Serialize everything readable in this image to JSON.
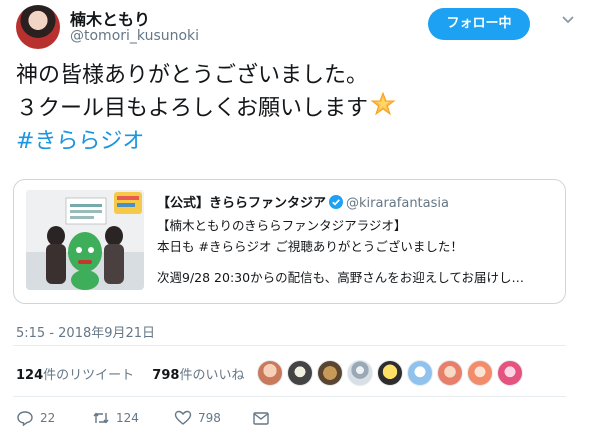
{
  "user": {
    "display_name": "楠木ともり",
    "handle": "@tomori_kusunoki",
    "avatar_icon": "profile-avatar"
  },
  "follow_button": {
    "label": "フォロー中"
  },
  "menu_icon": "chevron-down-icon",
  "tweet": {
    "lines": [
      "神の皆様ありがとうございました。",
      "３クール目もよろしくお願いします"
    ],
    "emoji": "glowing-star-icon",
    "hashtag": "#きららジオ"
  },
  "quoted_tweet": {
    "name": "【公式】きららファンタジア",
    "handle": "@kirarafantasia",
    "verified_icon": "verified-badge-icon",
    "lines": [
      "【楠木ともりのきららファンタジアラジオ】",
      "本日も #きららジオ ご視聴ありがとうございました！",
      "次週9/28 20:30からの配信も、高野さんをお迎えしてお届けし…"
    ]
  },
  "timestamp": "5:15 - 2018年9月21日",
  "stats": {
    "retweets": {
      "count": "124",
      "label": "件のリツイート"
    },
    "likes": {
      "count": "798",
      "label": "件のいいね"
    }
  },
  "actions": {
    "reply": {
      "icon": "reply-icon",
      "count": "22"
    },
    "retweet": {
      "icon": "retweet-icon",
      "count": "124"
    },
    "like": {
      "icon": "heart-icon",
      "count": "798"
    },
    "dm": {
      "icon": "envelope-icon"
    }
  },
  "colors": {
    "accent": "#1da1f2",
    "hashtag": "#1b95e0",
    "muted": "#657786"
  }
}
